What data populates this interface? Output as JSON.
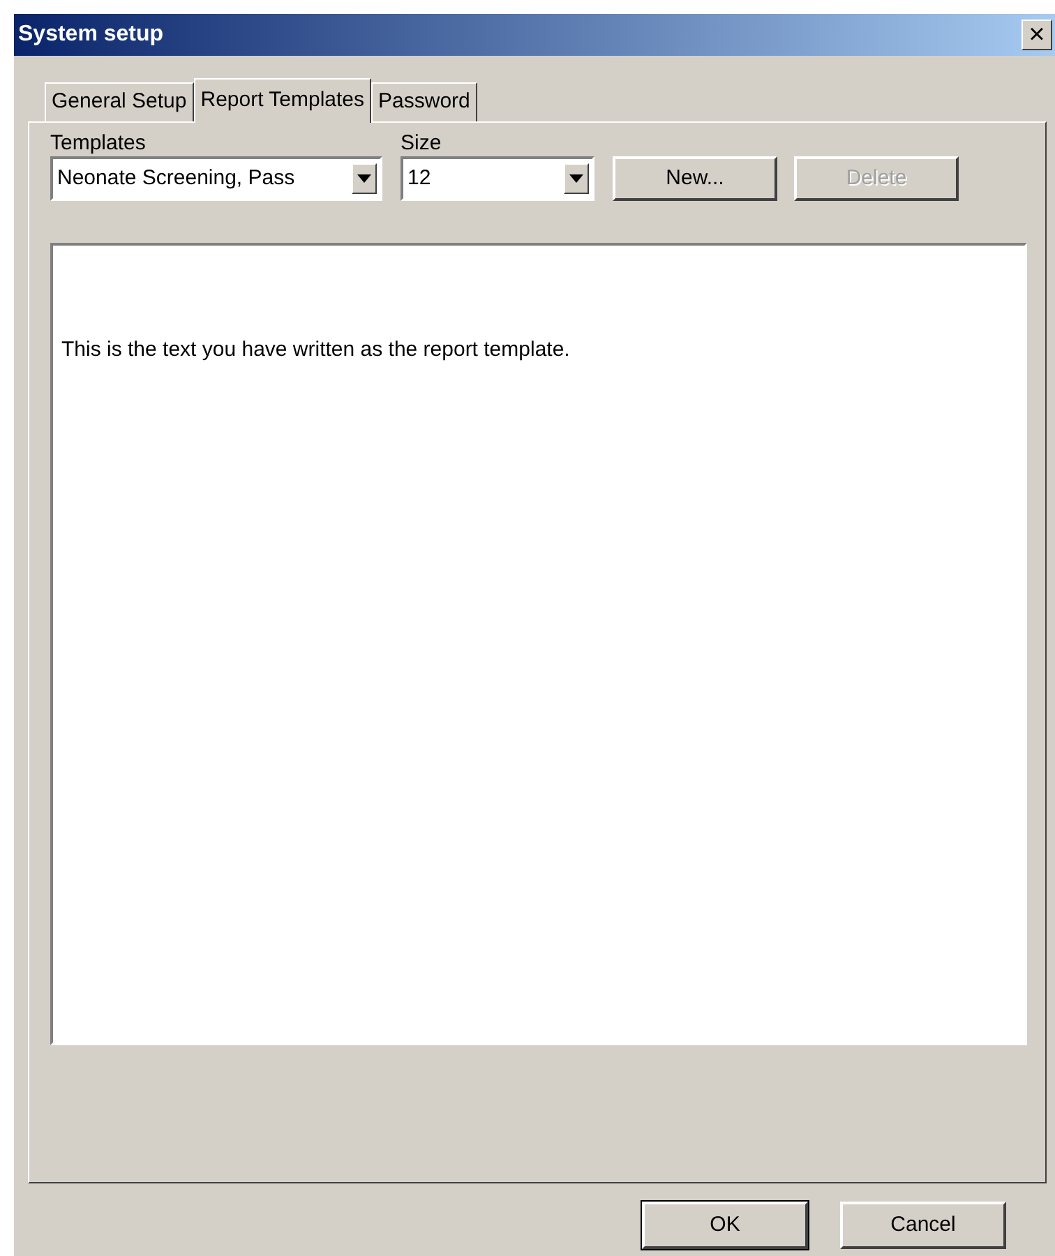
{
  "window": {
    "title": "System setup",
    "close": "×"
  },
  "tabs": [
    {
      "label": "General Setup",
      "selected": false
    },
    {
      "label": "Report Templates",
      "selected": true
    },
    {
      "label": "Password",
      "selected": false
    }
  ],
  "templates": {
    "label": "Templates",
    "value": "Neonate Screening, Pass"
  },
  "size": {
    "label": "Size",
    "value": "12"
  },
  "toolbar_buttons": [
    {
      "label": "New...",
      "disabled": false
    },
    {
      "label": "Delete",
      "disabled": true
    }
  ],
  "editor": {
    "text": "This is the text you have written as the report template."
  },
  "buttons": [
    {
      "label": "OK",
      "default": true
    },
    {
      "label": "Cancel",
      "default": false
    }
  ]
}
